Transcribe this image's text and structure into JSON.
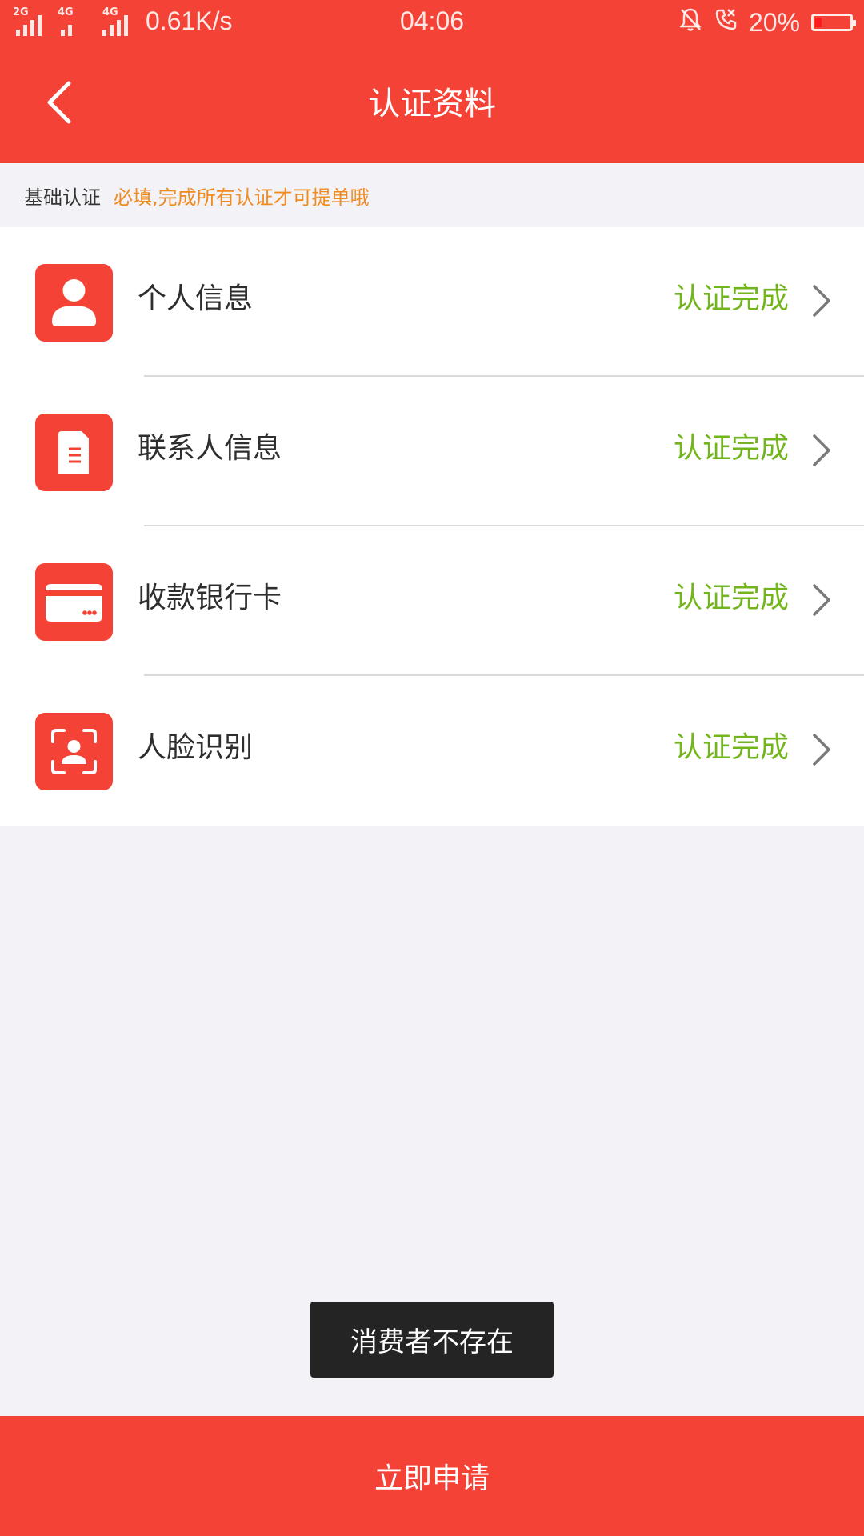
{
  "status_bar": {
    "net1_tag": "2G",
    "net2_tag": "4G",
    "net3_tag": "4G",
    "speed": "0.61K/s",
    "time": "04:06",
    "battery": "20%",
    "icons": [
      "signal-icon",
      "bell-off-icon",
      "call-icon",
      "battery-icon"
    ]
  },
  "header": {
    "title": "认证资料",
    "back_icon": "chevron-left-icon"
  },
  "section": {
    "label": "基础认证",
    "note": "必填,完成所有认证才可提单哦"
  },
  "items": [
    {
      "label": "个人信息",
      "status": "认证完成",
      "icon": "person-icon"
    },
    {
      "label": "联系人信息",
      "status": "认证完成",
      "icon": "document-icon"
    },
    {
      "label": "收款银行卡",
      "status": "认证完成",
      "icon": "bank-card-icon"
    },
    {
      "label": "人脸识别",
      "status": "认证完成",
      "icon": "face-scan-icon"
    }
  ],
  "toast": "消费者不存在",
  "apply_button": "立即申请",
  "colors": {
    "primary": "#f44336",
    "success": "#73b51d",
    "note": "#f28a1e",
    "background": "#f2f2f7"
  }
}
